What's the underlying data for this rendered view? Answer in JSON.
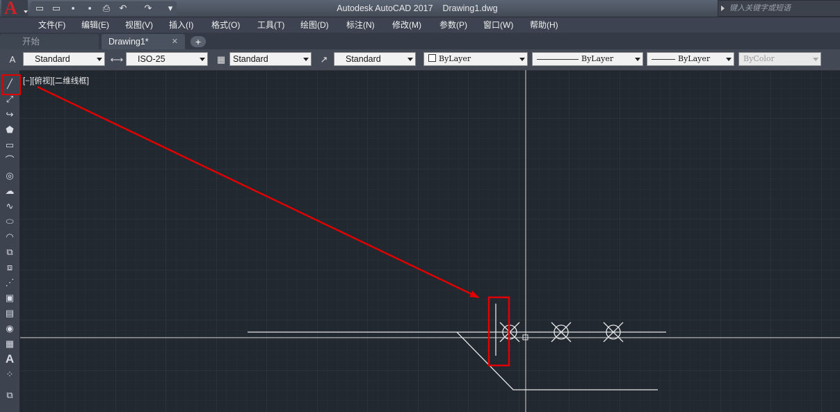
{
  "window": {
    "title": "Autodesk AutoCAD 2017    Drawing1.dwg",
    "search_placeholder": "键入关键字或短语"
  },
  "app_logo": "A",
  "quick_access": [
    "new-icon",
    "open-icon",
    "save-icon",
    "saveas-icon",
    "plot-icon",
    "undo-icon",
    "redo-icon",
    "customize-icon"
  ],
  "menu": [
    "文件(F)",
    "编辑(E)",
    "视图(V)",
    "插入(I)",
    "格式(O)",
    "工具(T)",
    "绘图(D)",
    "标注(N)",
    "修改(M)",
    "参数(P)",
    "窗口(W)",
    "帮助(H)"
  ],
  "tabs": [
    {
      "label": "开始",
      "active": false
    },
    {
      "label": "Drawing1*",
      "active": true
    }
  ],
  "tab_close": "✕",
  "tab_add": "+",
  "styles_toolbar": {
    "text_style": "Standard",
    "dim_style": "ISO-25",
    "table_style": "Standard",
    "mleader_style": "Standard"
  },
  "properties_toolbar": {
    "color": "ByLayer",
    "linetype": "ByLayer",
    "lineweight": "ByLayer",
    "plot_style": "ByColor"
  },
  "viewport_label": "[−][俯视][二维线框]",
  "left_toolbar": [
    "line-icon",
    "construction-line-icon",
    "polyline-icon",
    "polygon-icon",
    "rectangle-icon",
    "arc-icon",
    "circle-icon",
    "revision-cloud-icon",
    "spline-icon",
    "ellipse-icon",
    "ellipse-arc-icon",
    "insert-block-icon",
    "make-block-icon",
    "point-icon",
    "hatch-icon",
    "gradient-icon",
    "region-icon",
    "table-icon",
    "multiline-text-icon",
    "add-selected-icon",
    "extra-icon"
  ],
  "colors": {
    "canvas": "#212830",
    "highlight": "#e00000",
    "drawing": "#e8e8e8"
  }
}
